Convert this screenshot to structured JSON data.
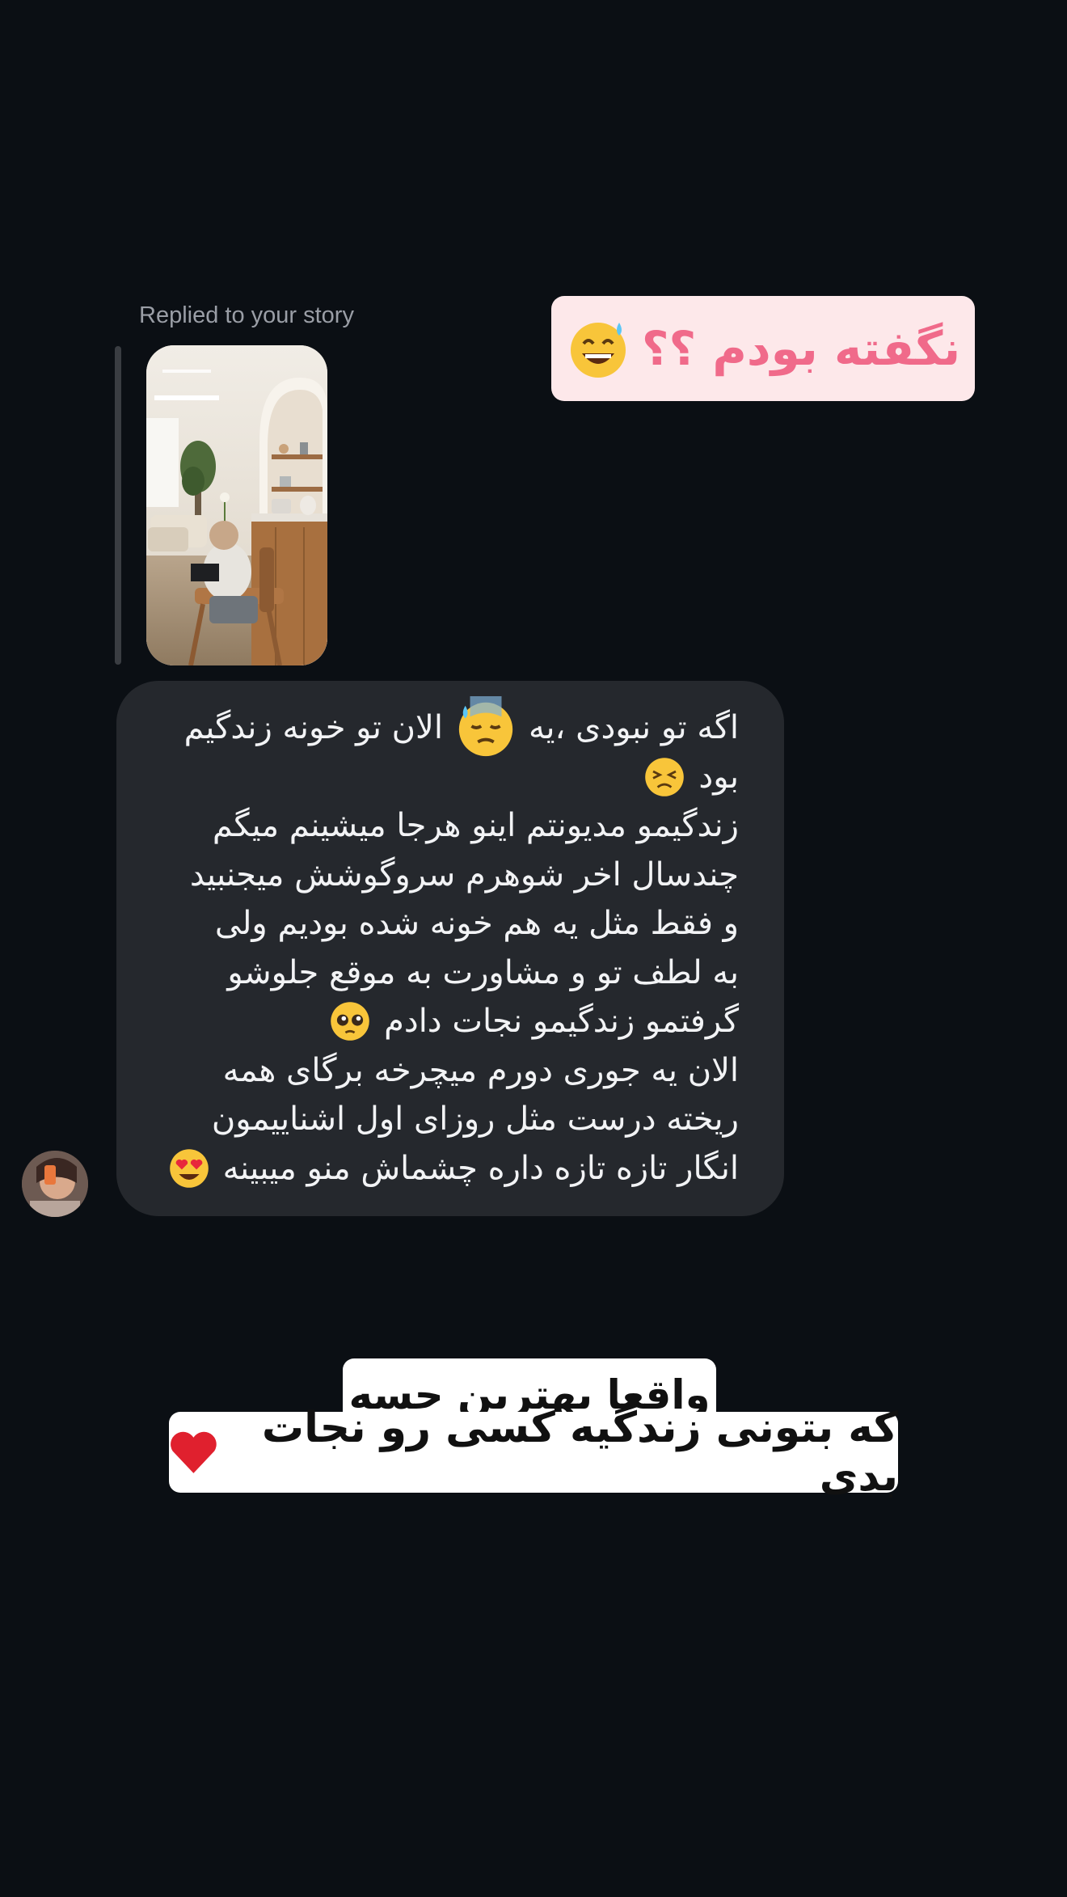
{
  "story_reply": {
    "label": "Replied to your story"
  },
  "sticker_top": {
    "text": "نگفته بودم ؟؟",
    "emoji": "grinning-face-with-sweat"
  },
  "message": {
    "lines": [
      "اگه تو نبودی ،یه",
      "الان تو خونه زندگیم",
      "بود",
      "زندگیمو مدیونتم اینو هرجا میشینم میگم",
      "چندسال اخر شوهرم سروگوشش میجنبید",
      "و فقط مثل یه هم خونه شده بودیم ولی",
      "به لطف تو و مشاورت به موقع جلوشو",
      "گرفتمو زندگیمو نجات دادم",
      "الان یه جوری دورم میچرخه برگای همه",
      "ریخته درست مثل روزای اول اشناییمون",
      "انگار تازه تازه داره چشماش منو میبینه"
    ],
    "emojis": [
      "downcast-face-with-sweat",
      "persevering-face",
      "pleading-face",
      "smiling-face-with-heart-eyes"
    ]
  },
  "caption": {
    "line1": "واقعا بهترین حسه",
    "line2": "که بتونی زندگیه کسی رو نجات بدی",
    "emoji": "red-heart"
  }
}
